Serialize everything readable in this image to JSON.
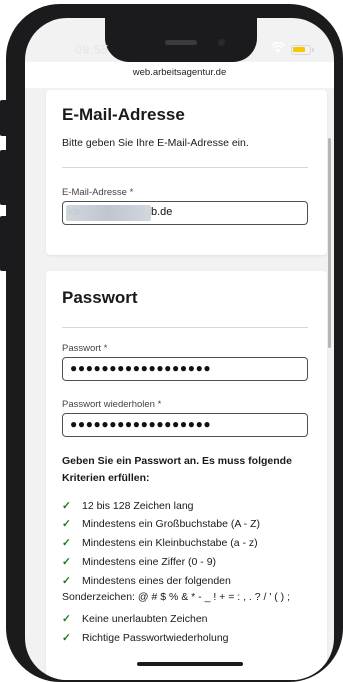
{
  "status_bar": {
    "time": "09:55",
    "wifi_icon": "wifi-icon",
    "battery_icon": "battery-icon"
  },
  "browser": {
    "url": "web.arbeitsagentur.de"
  },
  "email_card": {
    "title": "E-Mail-Adresse",
    "subtitle": "Bitte geben Sie Ihre E-Mail-Adresse ein.",
    "field_label": "E-Mail-Adresse *",
    "value_visible_start": "ka",
    "value_visible_end": "b.de"
  },
  "password_card": {
    "title": "Passwort",
    "password_label": "Passwort *",
    "password_mask": "●●●●●●●●●●●●●●●●●●",
    "repeat_label": "Passwort wiederholen *",
    "repeat_mask": "●●●●●●●●●●●●●●●●●●",
    "criteria_heading": "Geben Sie ein Passwort an. Es muss folgende Kriterien erfüllen:",
    "criteria": [
      "12 bis 128 Zeichen lang",
      "Mindestens ein Großbuchstabe (A - Z)",
      "Mindestens ein Kleinbuchstabe (a - z)",
      "Mindestens eine Ziffer (0 - 9)",
      "Mindestens eines der folgenden",
      "Keine unerlaubten Zeichen",
      "Richtige Passwortwiederholung"
    ],
    "special_chars_line": "Sonderzeichen: @ # $ % & * - _ ! + = : , . ? / ' ( ) ;",
    "check_glyph": "✓"
  },
  "colors": {
    "accent_check": "#1b7a1f",
    "battery": "#f5c800"
  }
}
